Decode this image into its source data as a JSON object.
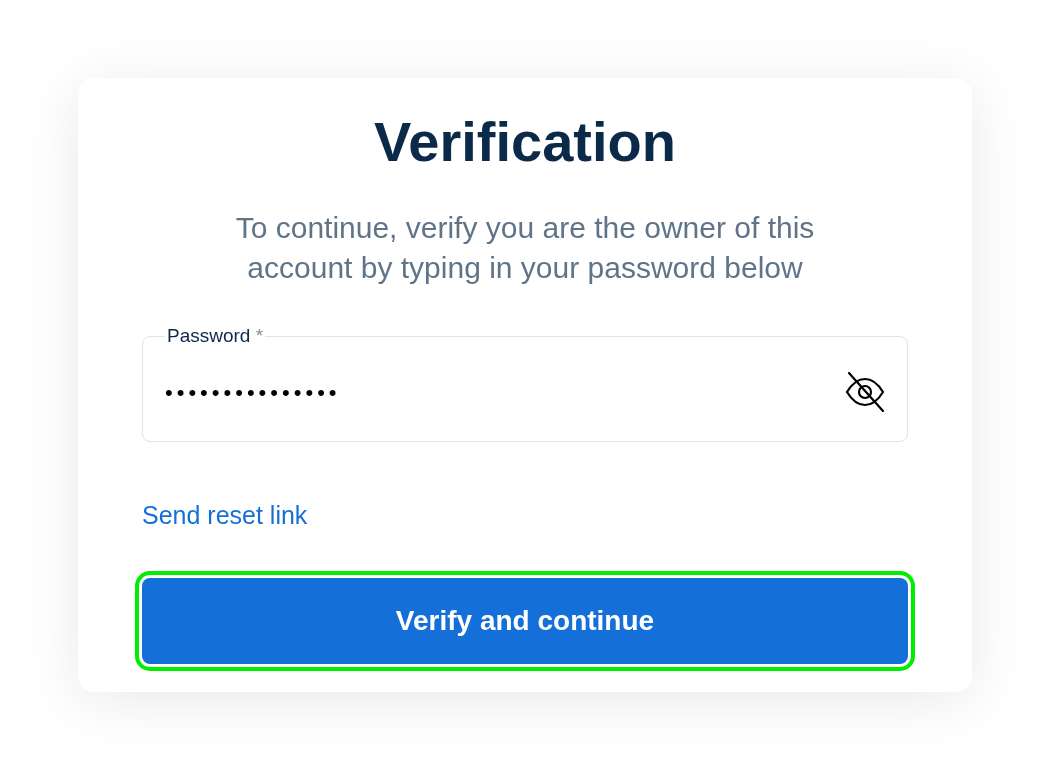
{
  "card": {
    "title": "Verification",
    "subtitle": "To continue, verify you are the owner of this account by typing in your password below"
  },
  "password_field": {
    "label": "Password",
    "required_mark": "*",
    "value": "•••••••••••••••"
  },
  "reset_link": "Send reset link",
  "submit_button": {
    "label": "Verify and continue",
    "focused": true
  }
}
